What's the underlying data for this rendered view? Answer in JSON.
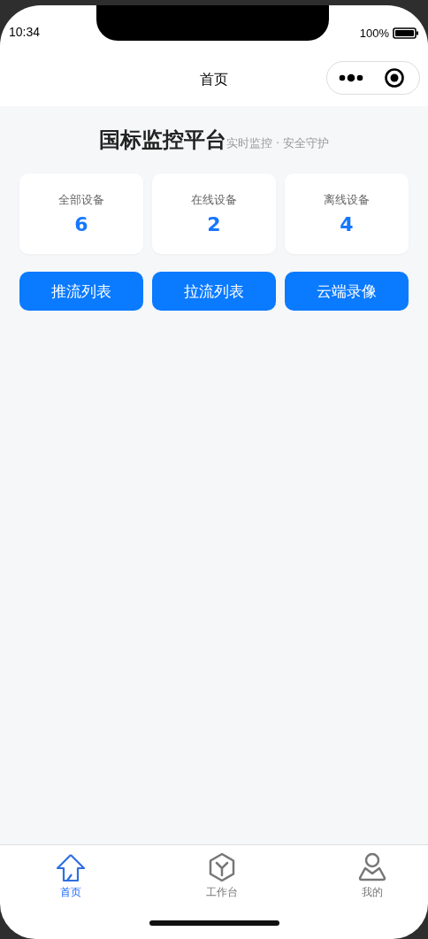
{
  "status_bar": {
    "time": "10:34",
    "battery": "100%"
  },
  "nav": {
    "title": "首页"
  },
  "header": {
    "title": "国标监控平台",
    "subtitle": "实时监控 · 安全守护"
  },
  "stats": [
    {
      "label": "全部设备",
      "value": "6"
    },
    {
      "label": "在线设备",
      "value": "2"
    },
    {
      "label": "离线设备",
      "value": "4"
    }
  ],
  "actions": [
    "推流列表",
    "拉流列表",
    "云端录像"
  ],
  "tabs": [
    {
      "label": "首页",
      "selected": true
    },
    {
      "label": "工作台",
      "selected": false
    },
    {
      "label": "我的",
      "selected": false
    }
  ]
}
